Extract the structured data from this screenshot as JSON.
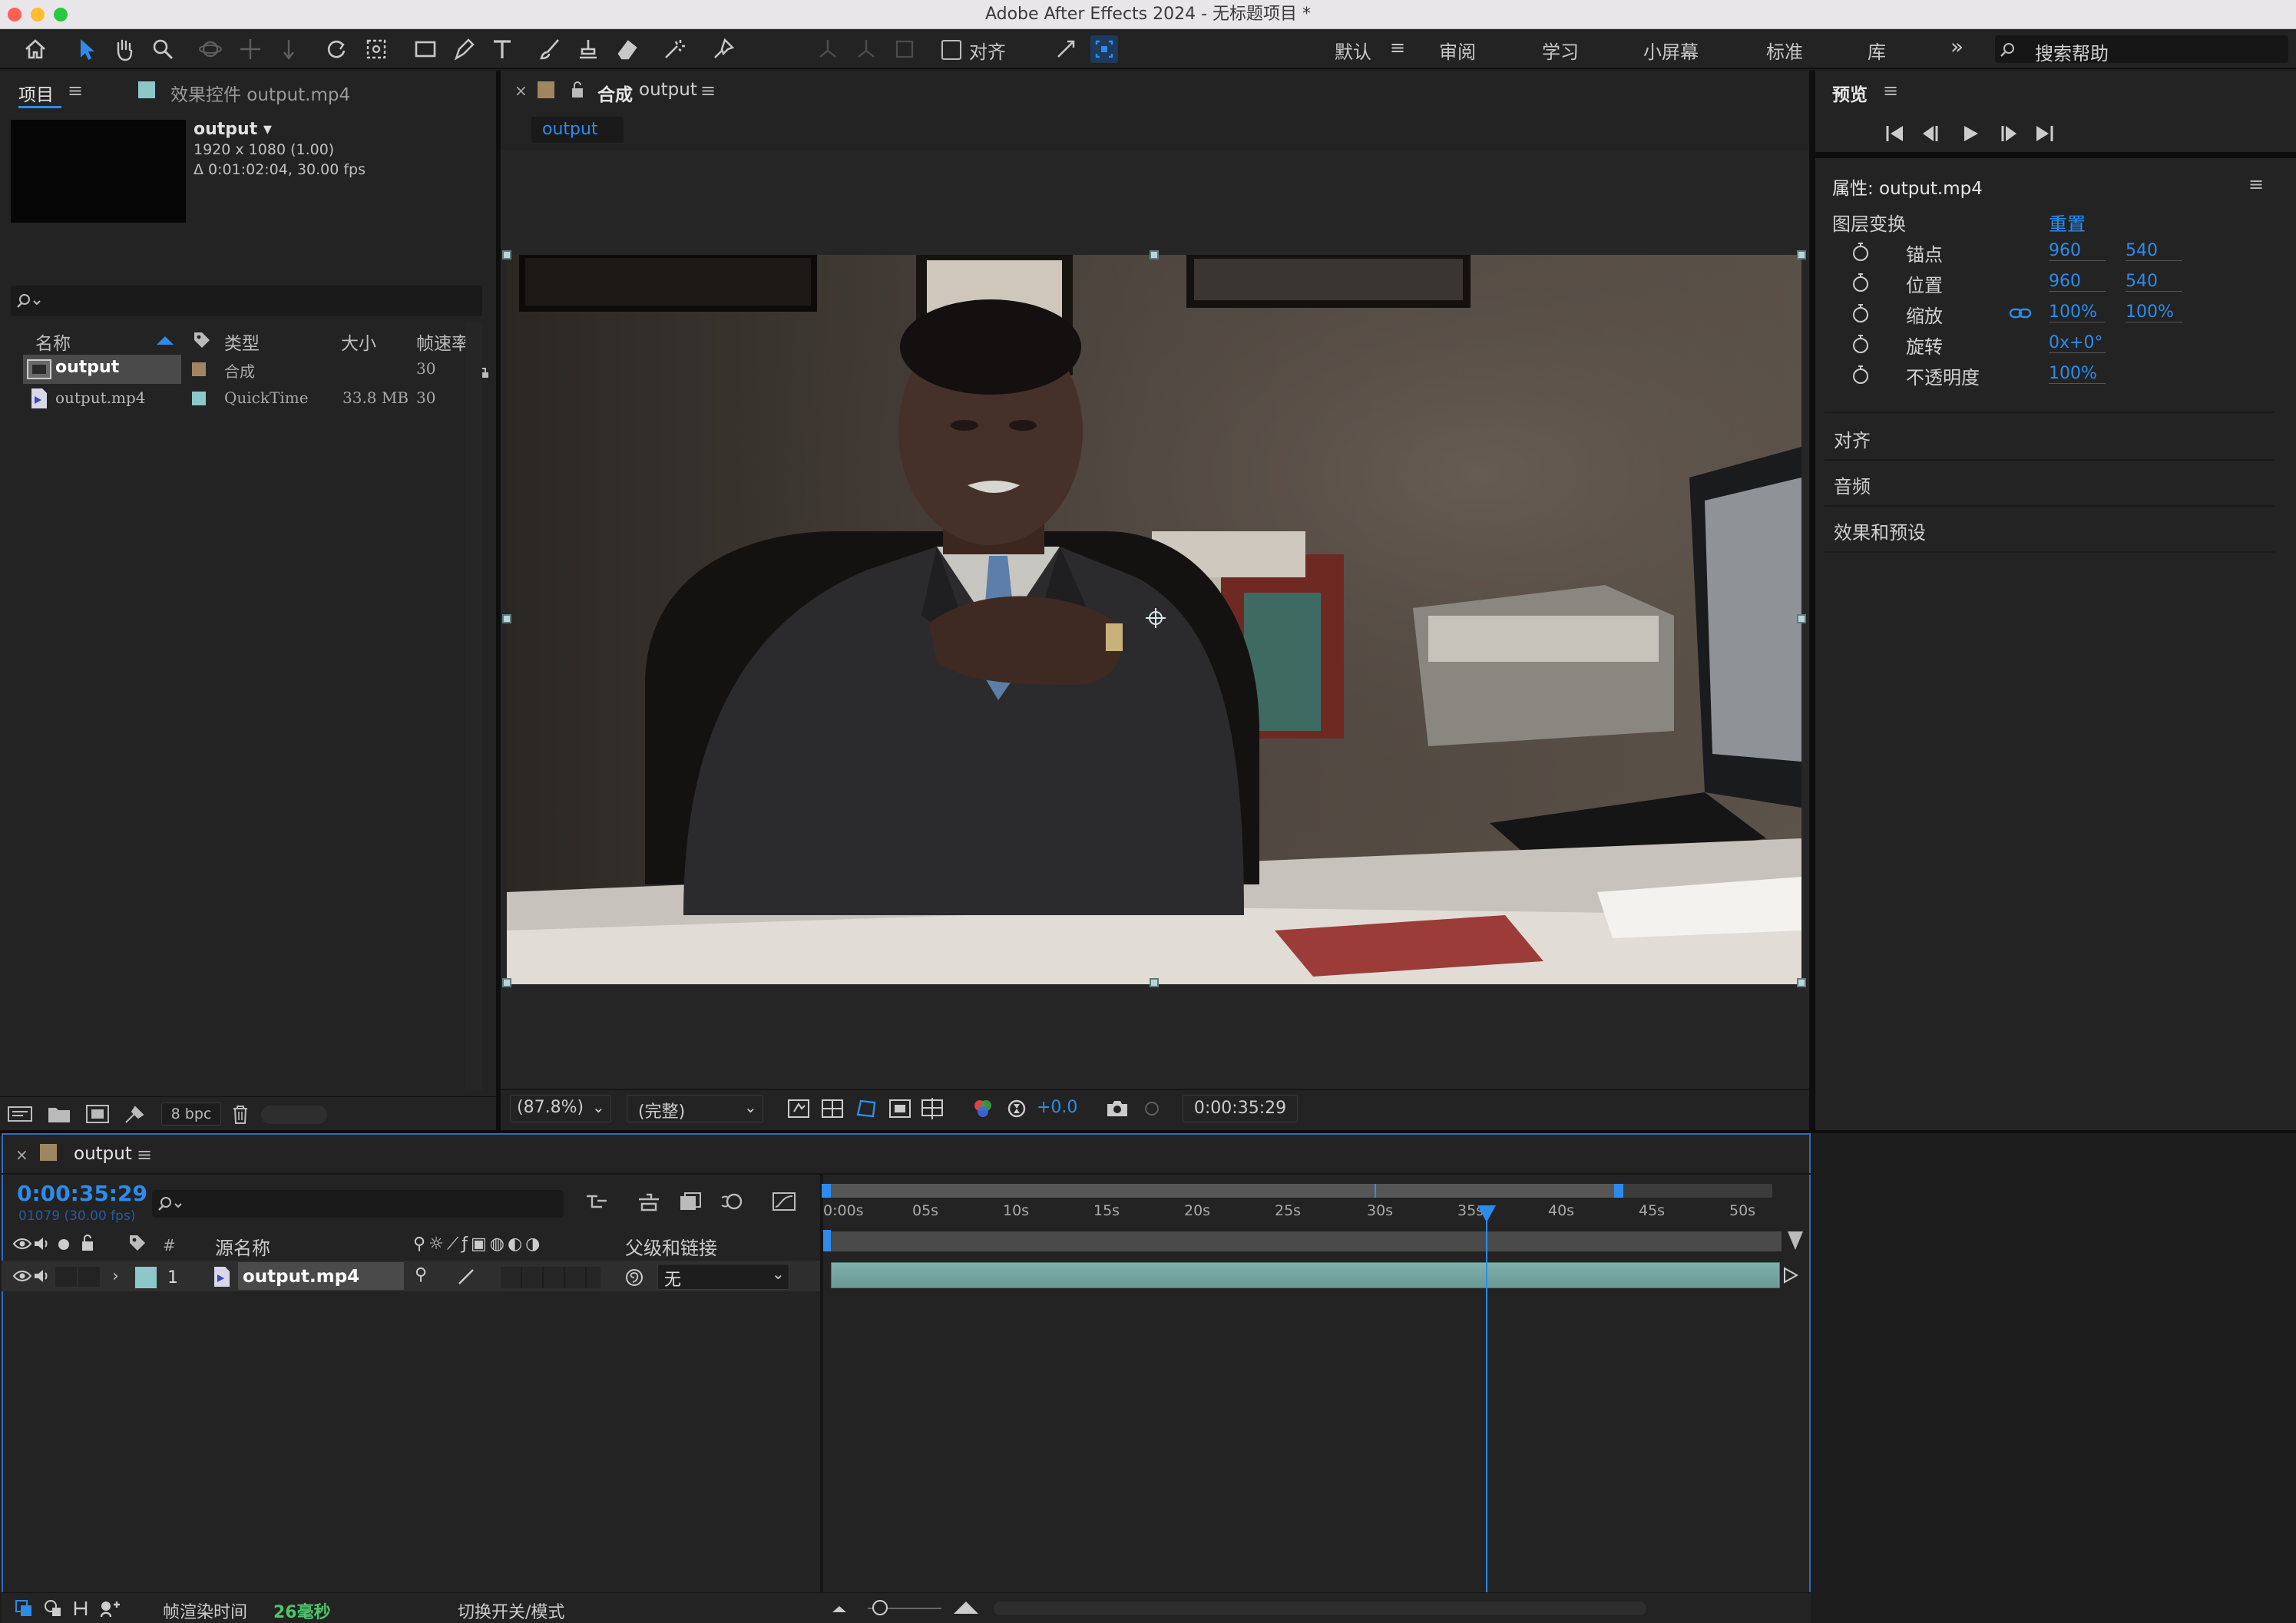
{
  "window": {
    "title": "Adobe After Effects 2024 - 无标题项目 *"
  },
  "workspaces": [
    {
      "label": "默认",
      "active": true
    },
    {
      "label": "审阅"
    },
    {
      "label": "学习"
    },
    {
      "label": "小屏幕"
    },
    {
      "label": "标准"
    },
    {
      "label": "库"
    }
  ],
  "toolbar": {
    "align_label": "对齐",
    "help_placeholder": "搜索帮助"
  },
  "project_panel": {
    "tab_project": "项目",
    "tab_effects": "效果控件 output.mp4",
    "selected_name": "output",
    "selected_name_arrow": "output ▾",
    "selected_res": "1920 x 1080 (1.00)",
    "selected_dur": "Δ 0:01:02:04, 30.00 fps",
    "columns": {
      "name": "名称",
      "type": "类型",
      "size": "大小",
      "fps": "帧速率"
    },
    "rows": [
      {
        "name": "output",
        "type": "合成",
        "size": "",
        "fps": "30",
        "color": "#a08660"
      },
      {
        "name": "output.mp4",
        "type": "QuickTime",
        "size": "33.8 MB",
        "fps": "30",
        "color": "#8cc8c8"
      }
    ],
    "bpc": "8 bpc"
  },
  "comp_panel": {
    "tab_prefix": "合成",
    "tab_name": "output",
    "breadcrumb": "output",
    "zoom": "(87.8%)",
    "quality": "(完整)",
    "exposure": "+0.0",
    "timecode": "0:00:35:29"
  },
  "right_panel": {
    "preview_title": "预览",
    "properties_title": "属性: output.mp4",
    "layer_transform": "图层变换",
    "reset": "重置",
    "props": [
      {
        "label": "锚点",
        "v1": "960",
        "v2": "540"
      },
      {
        "label": "位置",
        "v1": "960",
        "v2": "540"
      },
      {
        "label": "缩放",
        "v1": "100%",
        "v2": "100%"
      },
      {
        "label": "旋转",
        "v1": "0x+0°",
        "v2": ""
      },
      {
        "label": "不透明度",
        "v1": "100%",
        "v2": ""
      }
    ],
    "sections": [
      "对齐",
      "音频",
      "效果和预设"
    ]
  },
  "timeline": {
    "tab": "output",
    "timecode": "0:00:35:29",
    "frame_info": "01079 (30.00 fps)",
    "col_source": "源名称",
    "col_parent": "父级和链接",
    "layer": {
      "num": "1",
      "name": "output.mp4",
      "parent": "无",
      "color": "#8cc8c8"
    },
    "ticks": [
      "0:00s",
      "05s",
      "10s",
      "15s",
      "20s",
      "25s",
      "30s",
      "35s",
      "40s",
      "45s",
      "50s"
    ],
    "render_label": "帧渲染时间",
    "render_value": "26毫秒",
    "switch_mode": "切换开关/模式"
  }
}
